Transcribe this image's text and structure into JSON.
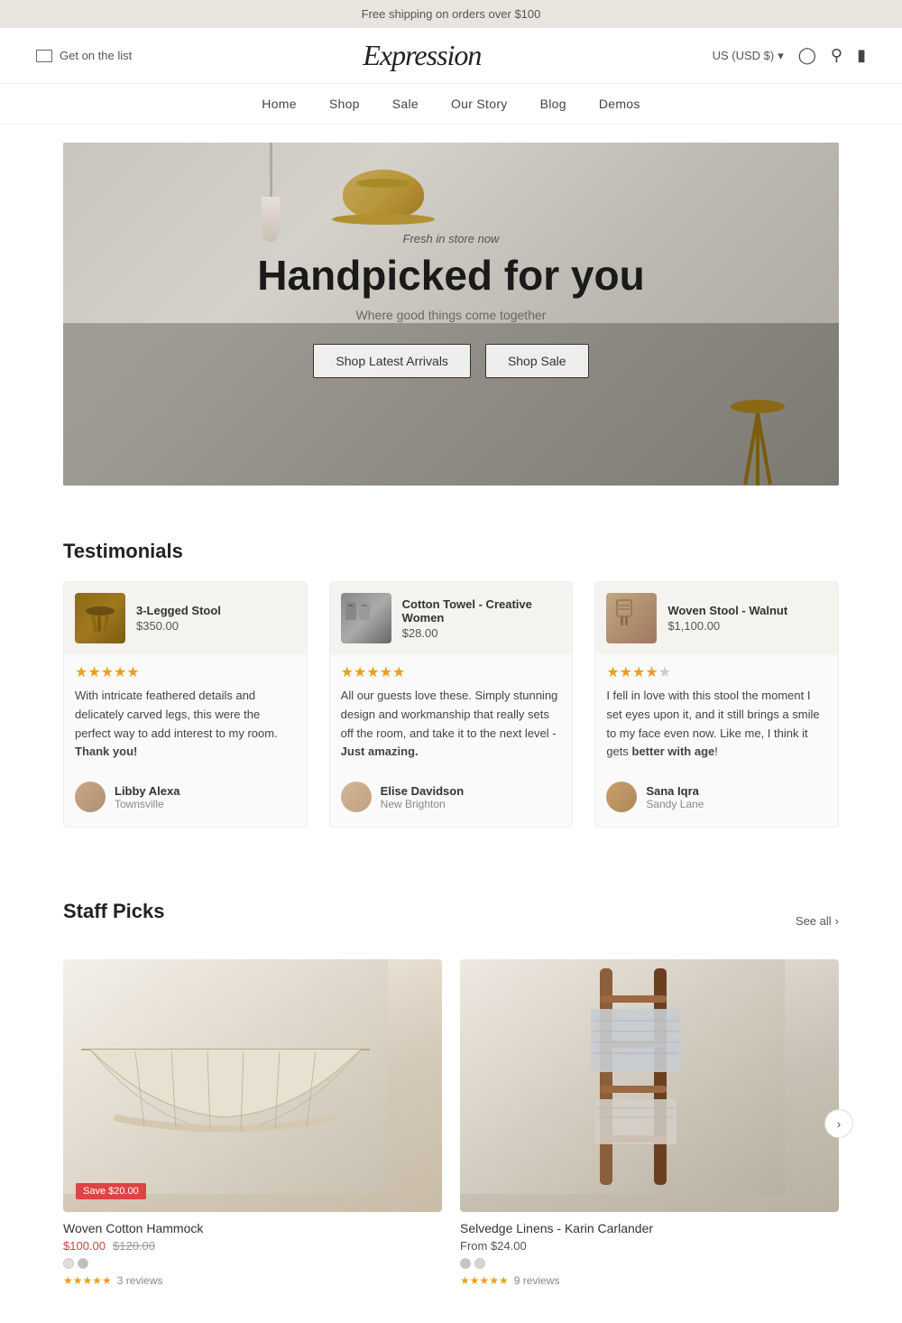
{
  "announcement": {
    "text": "Free shipping on orders over $100"
  },
  "header": {
    "email_label": "Get on the list",
    "logo": "Expression",
    "currency": "US (USD $)",
    "currency_arrow": "▾"
  },
  "nav": {
    "items": [
      {
        "label": "Home",
        "href": "#"
      },
      {
        "label": "Shop",
        "href": "#"
      },
      {
        "label": "Sale",
        "href": "#"
      },
      {
        "label": "Our Story",
        "href": "#"
      },
      {
        "label": "Blog",
        "href": "#"
      },
      {
        "label": "Demos",
        "href": "#"
      }
    ]
  },
  "hero": {
    "subtitle": "Fresh in store now",
    "title": "Handpicked for you",
    "description": "Where good things come together",
    "btn_arrivals": "Shop Latest Arrivals",
    "btn_sale": "Shop Sale"
  },
  "testimonials": {
    "section_title": "Testimonials",
    "items": [
      {
        "product_name": "3-Legged Stool",
        "product_price": "$350.00",
        "stars": "★★★★★",
        "text_plain": "With intricate feathered details and delicately carved legs, this were the perfect way to add interest to my room. ",
        "text_bold": "Thank you!",
        "text_suffix": "",
        "author_name": "Libby Alexa",
        "author_location": "Townsville"
      },
      {
        "product_name": "Cotton Towel - Creative Women",
        "product_price": "$28.00",
        "stars": "★★★★★",
        "text_plain": "All our guests love these. Simply stunning design and workmanship that really sets off the room, and take it to the next level - ",
        "text_bold": "Just amazing.",
        "text_suffix": "",
        "author_name": "Elise Davidson",
        "author_location": "New Brighton"
      },
      {
        "product_name": "Woven Stool - Walnut",
        "product_price": "$1,100.00",
        "stars": "★★★★",
        "text_plain": "I fell in love with this stool the moment I set eyes upon it, and it still brings a smile to my face even now. Like me, I think it gets ",
        "text_bold": "better with age",
        "text_suffix": "!",
        "author_name": "Sana Iqra",
        "author_location": "Sandy Lane"
      }
    ]
  },
  "staff_picks": {
    "section_title": "Staff Picks",
    "see_all": "See all",
    "products": [
      {
        "title": "Woven Cotton Hammock",
        "save_badge": "Save $20.00",
        "price_current": "$100.00",
        "price_original": "$120.00",
        "from_prefix": "",
        "swatches": [
          "#e0ddd8",
          "#c0bdb8"
        ],
        "stars": "★★★★★",
        "reviews": "3 reviews",
        "type": "hammock"
      },
      {
        "title": "Selvedge Linens - Karin Carlander",
        "save_badge": null,
        "price_from": "From $24.00",
        "swatches": [
          "#c8c5c0",
          "#d8d5d0"
        ],
        "stars": "★★★★★",
        "reviews": "9 reviews",
        "type": "linens"
      }
    ]
  }
}
